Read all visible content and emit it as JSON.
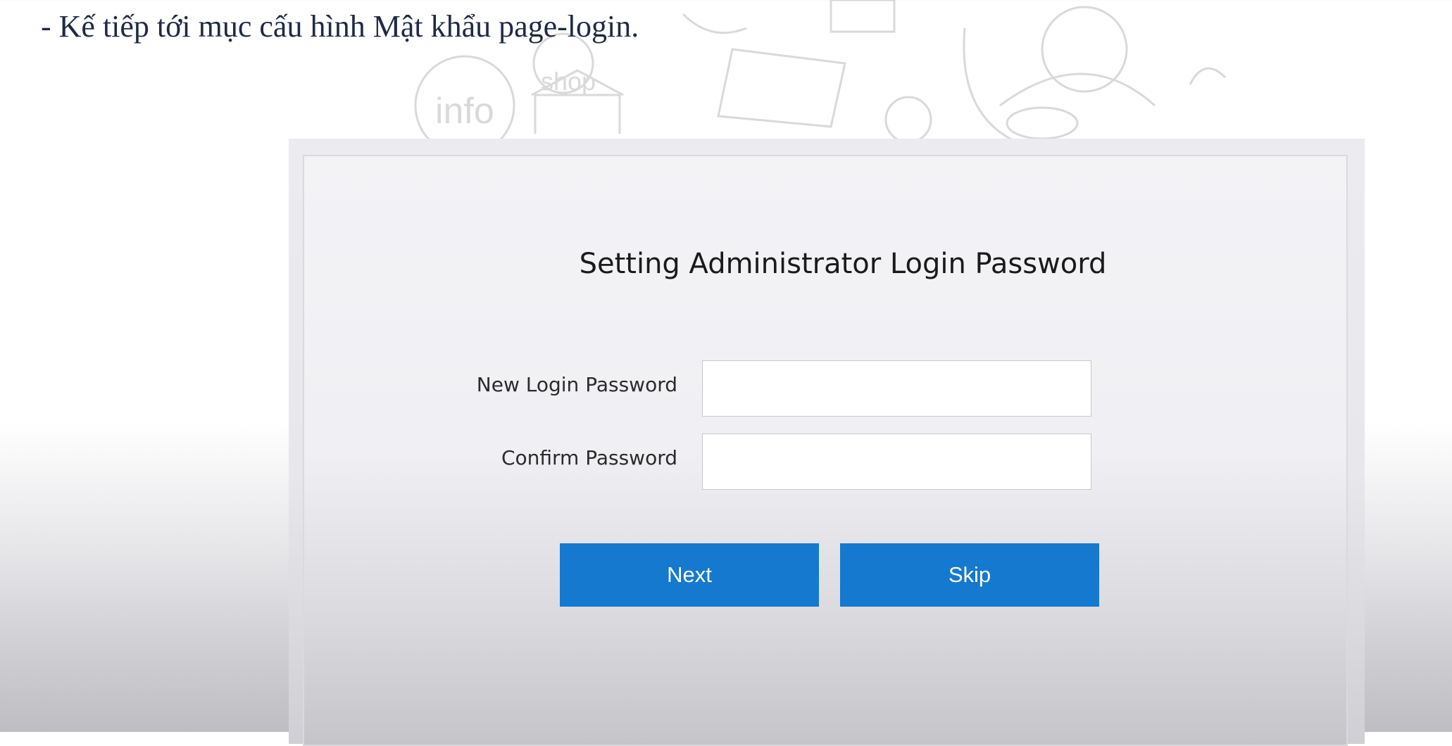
{
  "caption": {
    "text": "- Kế tiếp tới mục cấu hình Mật khẩu page-login."
  },
  "background": {
    "doodle_text_info": "info",
    "doodle_text_shop": "shop"
  },
  "dialog": {
    "title": "Setting Administrator Login Password",
    "fields": [
      {
        "label": "New Login Password",
        "value": "",
        "placeholder": ""
      },
      {
        "label": "Confirm Password",
        "value": "",
        "placeholder": ""
      }
    ],
    "buttons": {
      "next_label": "Next",
      "skip_label": "Skip"
    }
  },
  "colors": {
    "primary_button": "#1479cf",
    "button_text": "#ffffff",
    "caption_text": "#1f2a44",
    "panel_bg": "#f0f0f4"
  }
}
